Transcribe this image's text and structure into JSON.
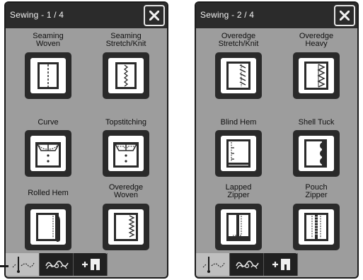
{
  "panels": [
    {
      "title": "Sewing - 1 / 4",
      "items": [
        {
          "label_line1": "Seaming",
          "label_line2": "Woven",
          "icon": "straight-stitch-icon"
        },
        {
          "label_line1": "Seaming",
          "label_line2": "Stretch/Knit",
          "icon": "stretch-stitch-icon"
        },
        {
          "label_line1": "Curve",
          "label_line2": "",
          "icon": "collar-icon"
        },
        {
          "label_line1": "Topstitching",
          "label_line2": "",
          "icon": "collar-topstitch-icon"
        },
        {
          "label_line1": "Rolled Hem",
          "label_line2": "",
          "icon": "rolled-hem-icon"
        },
        {
          "label_line1": "Overedge",
          "label_line2": "Woven",
          "icon": "overedge-woven-icon"
        }
      ]
    },
    {
      "title": "Sewing - 2 / 4",
      "items": [
        {
          "label_line1": "Overedge",
          "label_line2": "Stretch/Knit",
          "icon": "overedge-stretch-icon"
        },
        {
          "label_line1": "Overedge",
          "label_line2": "Heavy",
          "icon": "overedge-heavy-icon"
        },
        {
          "label_line1": "Blind Hem",
          "label_line2": "",
          "icon": "blind-hem-icon"
        },
        {
          "label_line1": "Shell Tuck",
          "label_line2": "",
          "icon": "shell-tuck-icon"
        },
        {
          "label_line1": "Lapped",
          "label_line2": "Zipper",
          "icon": "lapped-zipper-icon"
        },
        {
          "label_line1": "Pouch",
          "label_line2": "Zipper",
          "icon": "pouch-zipper-icon"
        }
      ]
    }
  ],
  "bottom_tabs": [
    {
      "name": "sewing-mode-tab",
      "icon": "needle-stitch-icon",
      "active": true
    },
    {
      "name": "decorative-mode-tab",
      "icon": "decorative-stitch-icon",
      "active": false
    },
    {
      "name": "add-presser-foot-tab",
      "icon": "add-foot-icon",
      "active": false
    }
  ],
  "colors": {
    "panel_bg": "#9d9d9d",
    "header_bg": "#2b2b2b",
    "button_bg": "#2a2a2a",
    "active_tab": "#bfbfbf"
  }
}
